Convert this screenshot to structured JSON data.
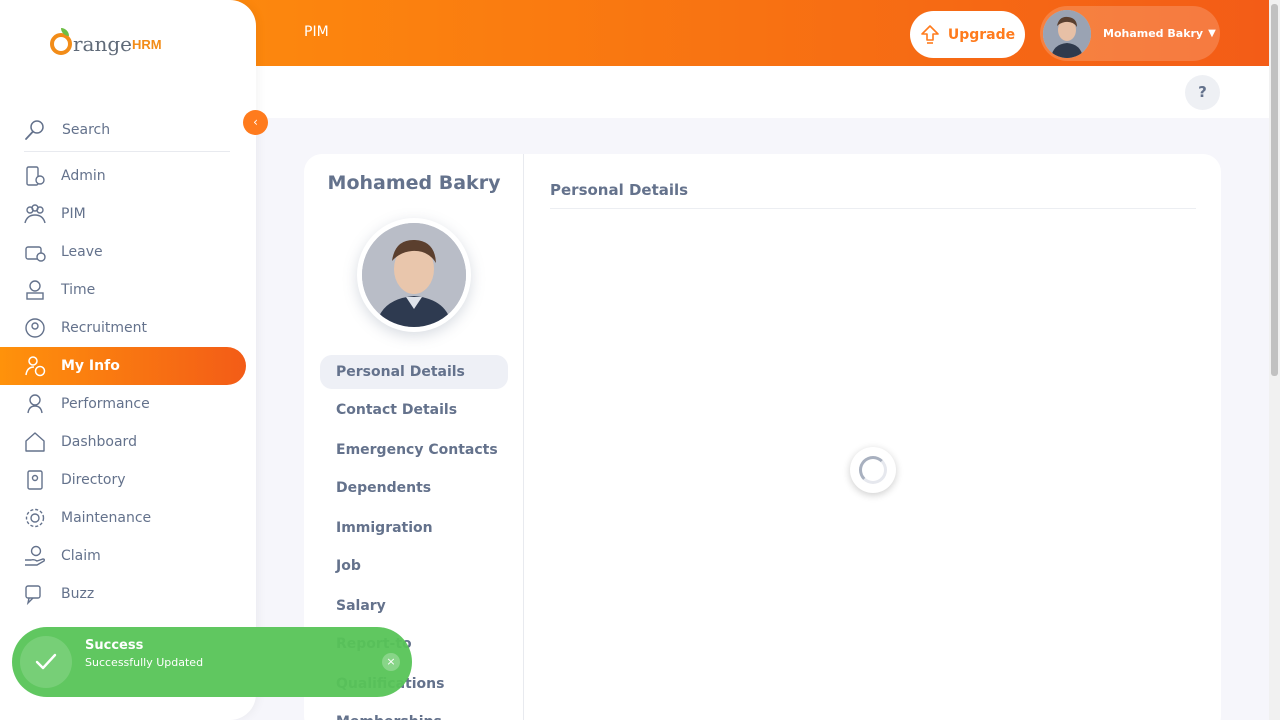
{
  "header": {
    "module_title": "PIM",
    "upgrade_label": "Upgrade",
    "user_name": "Mohamed Bakry",
    "help_label": "?"
  },
  "sidebar": {
    "logo_text": "range",
    "logo_hrm": "HRM",
    "search_label": "Search",
    "items": [
      {
        "label": "Admin",
        "icon": "admin-icon"
      },
      {
        "label": "PIM",
        "icon": "pim-icon"
      },
      {
        "label": "Leave",
        "icon": "leave-icon"
      },
      {
        "label": "Time",
        "icon": "time-icon"
      },
      {
        "label": "Recruitment",
        "icon": "recruitment-icon"
      },
      {
        "label": "My Info",
        "icon": "my-info-icon",
        "active": true
      },
      {
        "label": "Performance",
        "icon": "performance-icon"
      },
      {
        "label": "Dashboard",
        "icon": "dashboard-icon"
      },
      {
        "label": "Directory",
        "icon": "directory-icon"
      },
      {
        "label": "Maintenance",
        "icon": "maintenance-icon"
      },
      {
        "label": "Claim",
        "icon": "claim-icon"
      },
      {
        "label": "Buzz",
        "icon": "buzz-icon"
      }
    ]
  },
  "employee": {
    "name": "Mohamed Bakry"
  },
  "tabs": [
    {
      "label": "Personal Details",
      "active": true
    },
    {
      "label": "Contact Details"
    },
    {
      "label": "Emergency Contacts"
    },
    {
      "label": "Dependents"
    },
    {
      "label": "Immigration"
    },
    {
      "label": "Job"
    },
    {
      "label": "Salary"
    },
    {
      "label": "Report-to"
    },
    {
      "label": "Qualifications"
    },
    {
      "label": "Memberships"
    }
  ],
  "content": {
    "section_title": "Personal Details"
  },
  "toast": {
    "title": "Success",
    "message": "Successfully Updated",
    "close_label": "×"
  },
  "colors": {
    "accent": "#ff7b1d",
    "success": "#57c457",
    "text": "#64728c"
  }
}
